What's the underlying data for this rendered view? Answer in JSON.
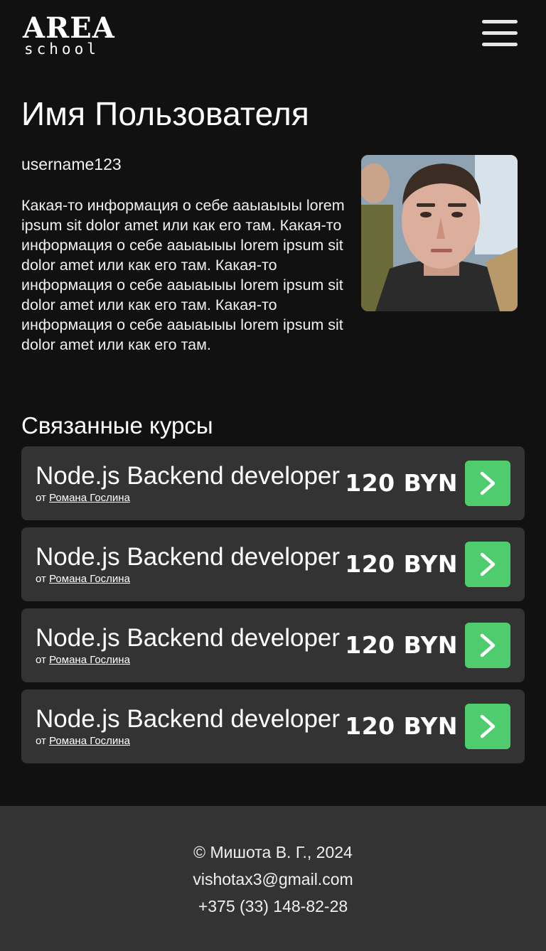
{
  "header": {
    "logo_top": "AREA",
    "logo_bottom": "school",
    "menu_icon": "hamburger-menu-icon"
  },
  "profile": {
    "name": "Имя Пользователя",
    "username": "username123",
    "bio": "Какая-то информация о себе ааыаыыы lorem ipsum sit dolor amet или как его там. Какая-то информация о себе ааыаыыы lorem ipsum sit dolor amet или как его там. Какая-то информация о себе ааыаыыы lorem ipsum sit dolor amet или как его там. Какая-то информация о себе ааыаыыы lorem ipsum sit dolor amet или как его там."
  },
  "courses": {
    "title": "Связанные курсы",
    "items": [
      {
        "title": "Node.js Backend developer",
        "author_prefix": "от",
        "author": "Романа Гослина",
        "price": "120 BYN"
      },
      {
        "title": "Node.js Backend developer",
        "author_prefix": "от",
        "author": "Романа Гослина",
        "price": "120 BYN"
      },
      {
        "title": "Node.js Backend developer",
        "author_prefix": "от",
        "author": "Романа Гослина",
        "price": "120 BYN"
      },
      {
        "title": "Node.js Backend developer",
        "author_prefix": "от",
        "author": "Романа Гослина",
        "price": "120 BYN"
      }
    ],
    "go_icon": "chevron-right-icon"
  },
  "footer": {
    "copyright": "© Мишота В. Г., 2024",
    "email": "vishotax3@gmail.com",
    "phone": "+375 (33) 148-82-28"
  },
  "colors": {
    "background": "#111111",
    "card": "#333333",
    "accent_green": "#4fcc6e",
    "text": "#ffffff"
  }
}
